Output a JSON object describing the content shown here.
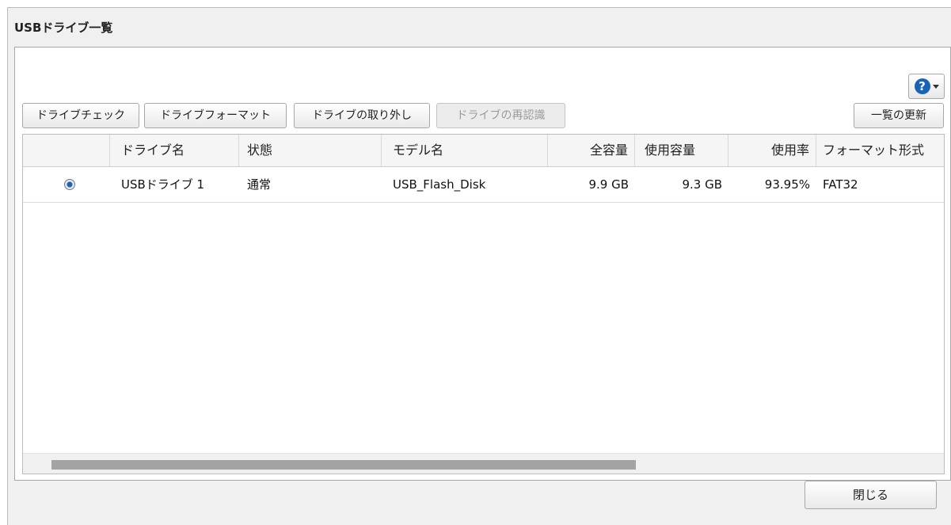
{
  "dialog": {
    "title": "USBドライブ一覧",
    "close_label": "閉じる"
  },
  "toolbar": {
    "drive_check": "ドライブチェック",
    "drive_format": "ドライブフォーマット",
    "drive_remove": "ドライブの取り外し",
    "drive_rerecognize": "ドライブの再認識",
    "refresh_list": "一覧の更新",
    "help_symbol": "?"
  },
  "table": {
    "columns": [
      "",
      "ドライブ名",
      "状態",
      "モデル名",
      "全容量",
      "使用容量",
      "使用率",
      "フォーマット形式"
    ],
    "rows": [
      {
        "selected": true,
        "drive_name": "USBドライブ 1",
        "status": "通常",
        "model": "USB_Flash_Disk",
        "total": "9.9 GB",
        "used": "9.3 GB",
        "usage_rate": "93.95%",
        "format": "FAT32"
      }
    ]
  },
  "icons": {
    "help": "help-icon",
    "dropdown": "chevron-down-icon",
    "radio": "radio-selected-icon"
  },
  "colors": {
    "help_blue": "#1a62b8",
    "scroll_thumb": "#a3a3a3"
  }
}
